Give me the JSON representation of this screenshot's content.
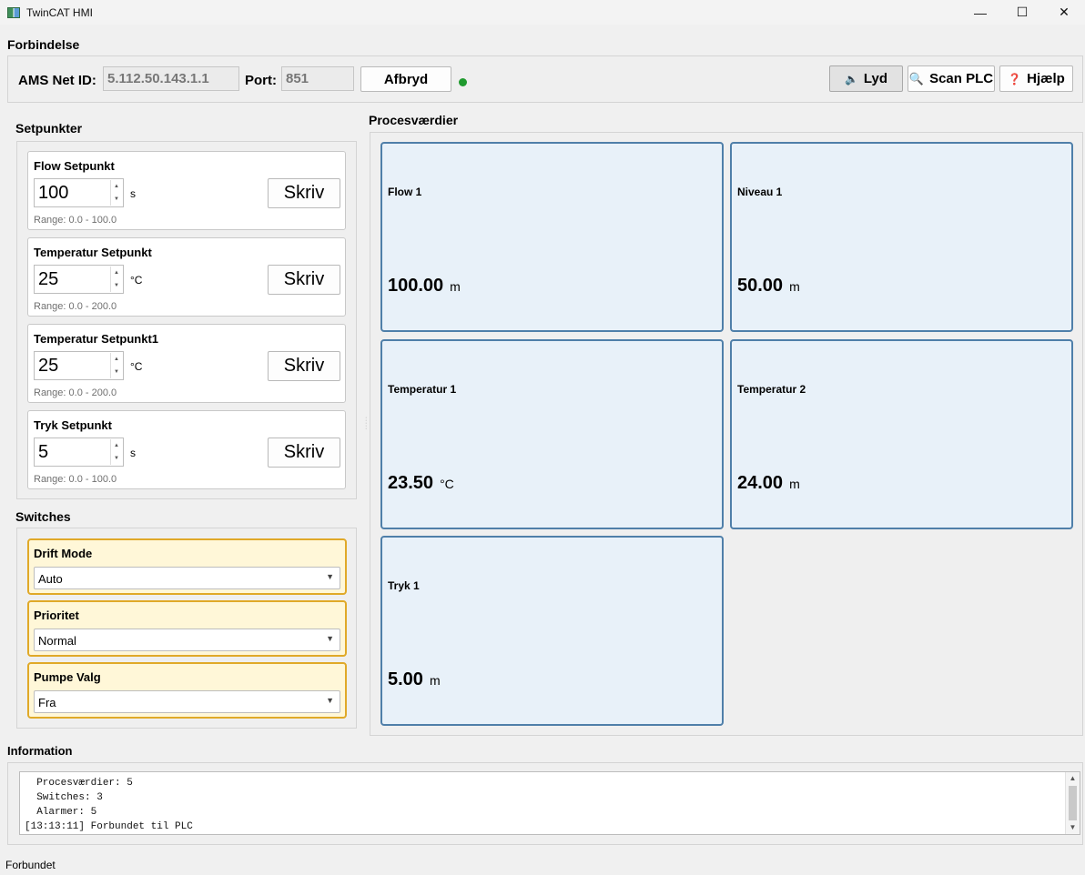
{
  "window": {
    "title": "TwinCAT HMI",
    "minimize": "—",
    "maximize": "☐",
    "close": "✕"
  },
  "connection": {
    "section_title": "Forbindelse",
    "ams_label": "AMS Net ID:",
    "ams_value": "5.112.50.143.1.1",
    "port_label": "Port:",
    "port_value": "851",
    "disconnect_label": "Afbryd",
    "status_color": "#1f9a2e",
    "sound_label": "Lyd",
    "sound_icon": "🔈",
    "scan_label": "Scan PLC",
    "scan_icon": "🔍",
    "help_label": "Hjælp",
    "help_icon": "❓"
  },
  "setpoints": {
    "section_title": "Setpunkter",
    "items": [
      {
        "title": "Flow Setpunkt",
        "value": "100",
        "unit": "s",
        "button": "Skriv",
        "range": "Range: 0.0 - 100.0"
      },
      {
        "title": "Temperatur Setpunkt",
        "value": "25",
        "unit": "°C",
        "button": "Skriv",
        "range": "Range: 0.0 - 200.0"
      },
      {
        "title": "Temperatur Setpunkt1",
        "value": "25",
        "unit": "°C",
        "button": "Skriv",
        "range": "Range: 0.0 - 200.0"
      },
      {
        "title": "Tryk Setpunkt",
        "value": "5",
        "unit": "s",
        "button": "Skriv",
        "range": "Range: 0.0 - 100.0"
      }
    ]
  },
  "switches": {
    "section_title": "Switches",
    "items": [
      {
        "title": "Drift Mode",
        "value": "Auto"
      },
      {
        "title": "Prioritet",
        "value": "Normal"
      },
      {
        "title": "Pumpe Valg",
        "value": "Fra"
      }
    ]
  },
  "process": {
    "section_title": "Procesværdier",
    "items": [
      {
        "title": "Flow 1",
        "value": "100.00",
        "unit": "m"
      },
      {
        "title": "Niveau 1",
        "value": "50.00",
        "unit": "m"
      },
      {
        "title": "Temperatur 1",
        "value": "23.50",
        "unit": "°C"
      },
      {
        "title": "Temperatur 2",
        "value": "24.00",
        "unit": "m"
      },
      {
        "title": "Tryk 1",
        "value": "5.00",
        "unit": "m"
      }
    ]
  },
  "information": {
    "section_title": "Information",
    "lines": [
      "  Procesværdier: 5",
      "  Switches: 3",
      "  Alarmer: 5",
      "[13:13:11] Forbundet til PLC"
    ]
  },
  "status_bar": {
    "text": "Forbundet"
  }
}
